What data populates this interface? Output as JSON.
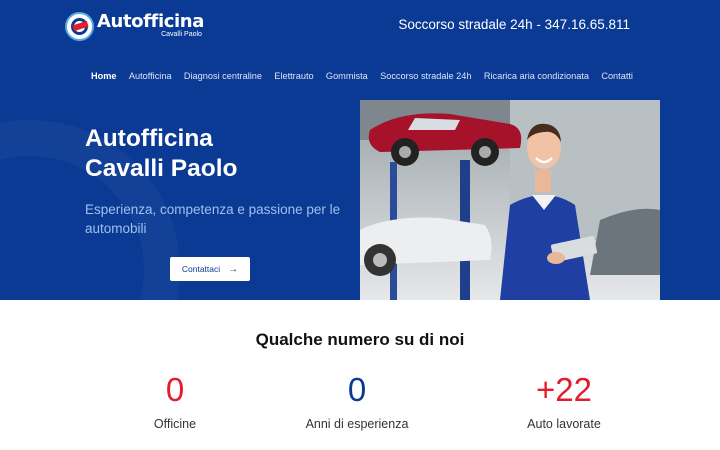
{
  "brand": {
    "name": "Autofficina",
    "subname": "Cavalli Paolo",
    "logo_icon": "car-wrench-logo",
    "colors": {
      "primary": "#0a3a93",
      "accent": "#e31d2a",
      "white": "#ffffff"
    }
  },
  "header": {
    "phone_text": "Soccorso stradale 24h - 347.16.65.811"
  },
  "nav": {
    "items": [
      {
        "label": "Home",
        "active": true
      },
      {
        "label": "Autofficina"
      },
      {
        "label": "Diagnosi centraline"
      },
      {
        "label": "Elettrauto"
      },
      {
        "label": "Gommista"
      },
      {
        "label": "Soccorso stradale 24h"
      },
      {
        "label": "Ricarica aria condizionata"
      },
      {
        "label": "Contatti"
      }
    ]
  },
  "hero": {
    "title_line1": "Autofficina",
    "title_line2": "Cavalli Paolo",
    "subtitle": "Esperienza, competenza e passione per le automobili",
    "cta_label": "Contattaci",
    "cta_icon": "arrow-right-icon"
  },
  "stats": {
    "title": "Qualche numero su di noi",
    "items": [
      {
        "value": "0",
        "label": "Officine",
        "color": "#e31d2a"
      },
      {
        "value": "0",
        "label": "Anni di esperienza",
        "color": "#0a3a93"
      },
      {
        "value": "+22",
        "label": "Auto lavorate",
        "color": "#e31d2a"
      }
    ]
  }
}
